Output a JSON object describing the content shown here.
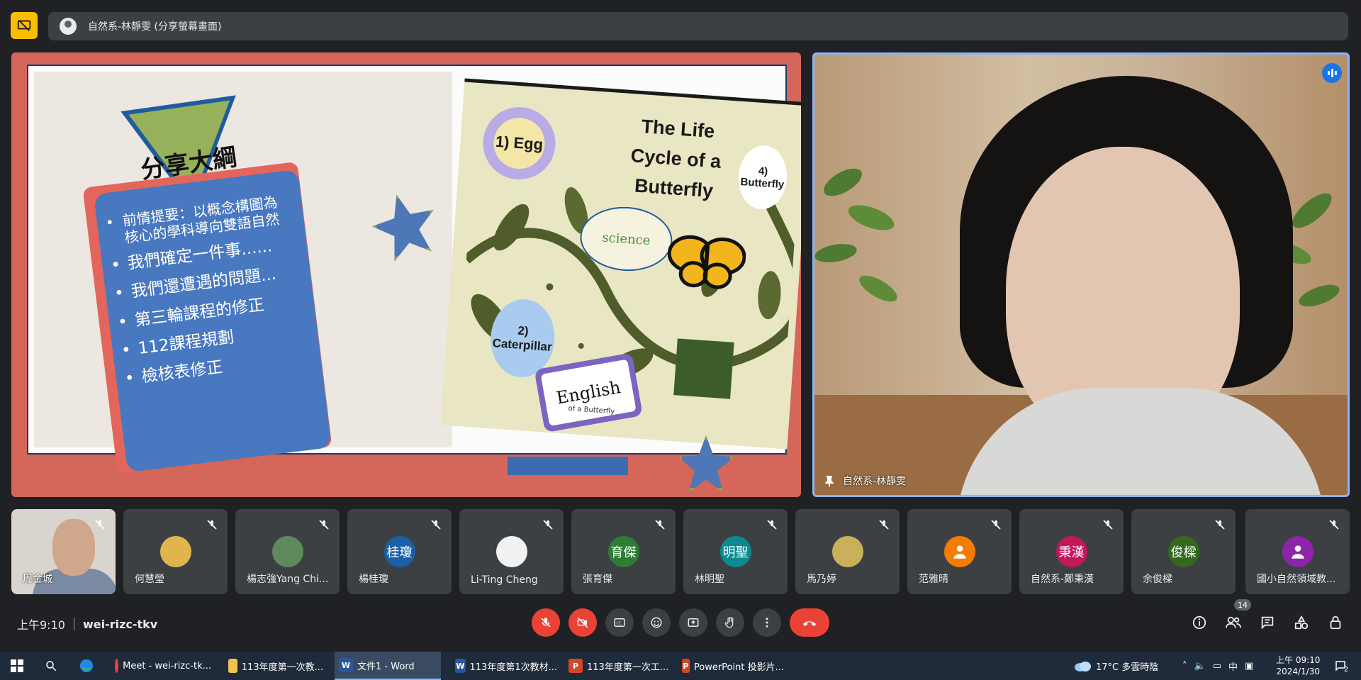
{
  "presenter": {
    "label": "自然系-林靜雯 (分享螢幕畫面)"
  },
  "slide": {
    "title": "分享大綱",
    "bullets": [
      "前情提要：以概念構圖為核心的學科導向雙語自然",
      "我們確定一件事......",
      "我們還遭遇的問題...",
      "第三輪課程的修正",
      "112課程規劃",
      "檢核表修正"
    ],
    "butterfly": {
      "title": "The Life Cycle of a Butterfly",
      "stage_egg": "1) Egg",
      "stage_caterpillar": "2) Caterpillar",
      "stage_butterfly": "4) Butterfly",
      "science_label": "science",
      "english_label": "English",
      "footer": "of a Butterfly"
    }
  },
  "speaker": {
    "name": "自然系-林靜雯",
    "speaking_icon": "audio-level-icon",
    "pin_icon": "pin-icon"
  },
  "participants": [
    {
      "name": "周金城",
      "initial": "",
      "color": "#7a8aa2",
      "video": true
    },
    {
      "name": "何慧瑩",
      "initial": "",
      "color": "#e0b54e"
    },
    {
      "name": "楊志強Yang Chi...",
      "initial": "",
      "color": "#5f8a5b"
    },
    {
      "name": "楊桂瓊",
      "initial": "桂瓊",
      "color": "#1a5fa8"
    },
    {
      "name": "Li-Ting Cheng",
      "initial": "",
      "color": "#f1f1f1"
    },
    {
      "name": "張育傑",
      "initial": "育傑",
      "color": "#2e7d32"
    },
    {
      "name": "林明聖",
      "initial": "明聖",
      "color": "#0b8a8f"
    },
    {
      "name": "馬乃婷",
      "initial": "",
      "color": "#c9b15a"
    },
    {
      "name": "范雅晴",
      "initial": "",
      "color": "#f57c00"
    },
    {
      "name": "自然系-鄭秉漢",
      "initial": "秉漢",
      "color": "#c2185b"
    },
    {
      "name": "余俊樑",
      "initial": "俊樑",
      "color": "#33691e"
    },
    {
      "name": "國小自然領域教...",
      "initial": "",
      "color": "#8e24aa"
    }
  ],
  "controls": {
    "time": "上午9:10",
    "meeting_code": "wei-rizc-tkv",
    "people_count": "14",
    "buttons": [
      "mic-off-icon",
      "camera-off-icon",
      "captions-icon",
      "emoji-icon",
      "present-icon",
      "raise-hand-icon",
      "more-options-icon"
    ],
    "end_call": "end-call-icon",
    "right_buttons": [
      "info-icon",
      "people-icon",
      "chat-icon",
      "activities-icon",
      "host-controls-icon"
    ]
  },
  "taskbar": {
    "apps": [
      {
        "label": "Meet - wei-rizc-tk...",
        "icon": "chrome-icon",
        "color": "#e8453c"
      },
      {
        "label": "113年度第一次教...",
        "icon": "folder-icon",
        "color": "#f2c14e"
      },
      {
        "label": "文件1 - Word",
        "icon": "word-icon",
        "color": "#2b579a",
        "active": true
      },
      {
        "label": "113年度第1次教材...",
        "icon": "word-icon",
        "color": "#2b579a"
      },
      {
        "label": "113年度第一次工...",
        "icon": "powerpoint-icon",
        "color": "#d24726"
      },
      {
        "label": "PowerPoint 投影片...",
        "icon": "powerpoint-show-icon",
        "color": "#d24726"
      }
    ],
    "weather": "17°C 多雲時陰",
    "ime": "中",
    "clock_time": "上午 09:10",
    "clock_date": "2024/1/30",
    "notification_count": "2"
  }
}
